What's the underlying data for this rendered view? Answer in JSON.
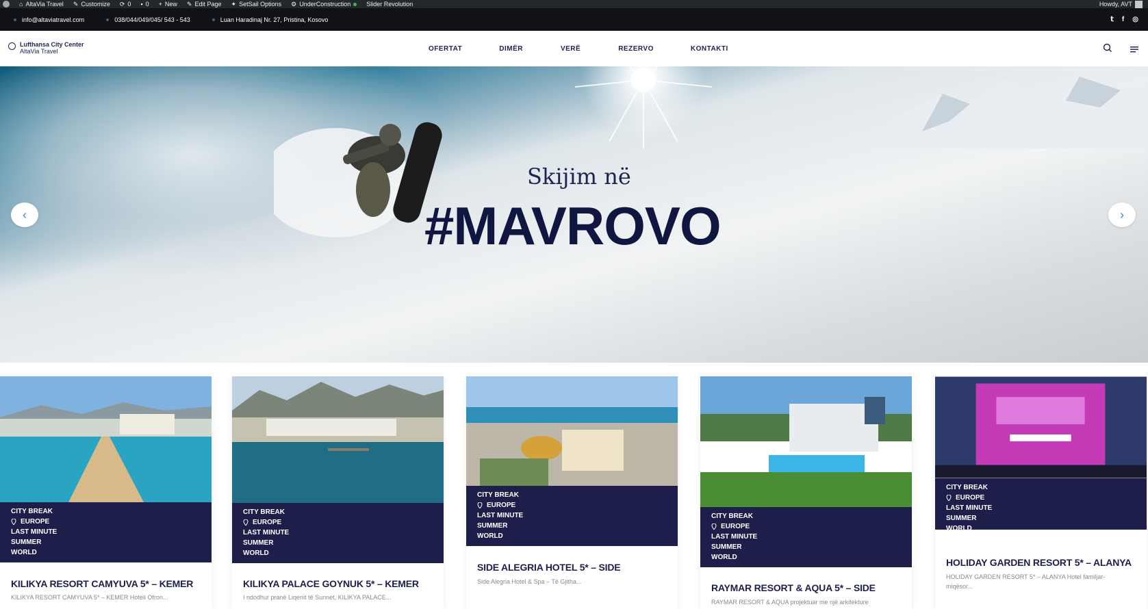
{
  "adminbar": {
    "site": "AltaVia Travel",
    "customize": "Customize",
    "updates_count": "0",
    "comments_count": "0",
    "new": "New",
    "edit_page": "Edit Page",
    "setsail": "SetSail Options",
    "underconstruction": "UnderConstruction",
    "slider": "Slider Revolution",
    "howdy": "Howdy, AVT"
  },
  "topbar": {
    "email": "info@altaviatravel.com",
    "phones": "038/044/049/045/ 543 - 543",
    "address": "Luan Haradinaj Nr. 27, Pristina, Kosovo",
    "social": [
      "twitter-icon",
      "facebook-icon",
      "instagram-icon"
    ],
    "social_glyphs": [
      "𝕥",
      "f",
      "◎"
    ]
  },
  "header": {
    "logo_line1": "Lufthansa City Center",
    "logo_line2": "AltaVia Travel",
    "nav": [
      "OFERTAT",
      "DIMËR",
      "VERË",
      "REZERVO",
      "KONTAKTI"
    ]
  },
  "hero": {
    "subtitle": "Skijim në",
    "title": "#MAVROVO",
    "prev_glyph": "‹",
    "next_glyph": "›"
  },
  "cards": [
    {
      "tags": [
        "CITY BREAK",
        "EUROPE",
        "LAST MINUTE",
        "SUMMER",
        "WORLD"
      ],
      "title": "KILIKYA RESORT CAMYUVA 5* – KEMER",
      "desc": "KILIKYA RESORT CAMYUVA 5* – KEMER Hoteli Ofron..."
    },
    {
      "tags": [
        "CITY BREAK",
        "EUROPE",
        "LAST MINUTE",
        "SUMMER",
        "WORLD"
      ],
      "title": "KILIKYA PALACE GOYNUK 5* – KEMER",
      "desc": "I ndodhur pranë Liqenit të Sunnet, KILIKYA PALACE..."
    },
    {
      "tags": [
        "CITY BREAK",
        "EUROPE",
        "LAST MINUTE",
        "SUMMER",
        "WORLD"
      ],
      "title": "SIDE ALEGRIA HOTEL 5* – SIDE",
      "desc": "Side Alegria Hotel & Spa – Të Gjitha..."
    },
    {
      "tags": [
        "CITY BREAK",
        "EUROPE",
        "LAST MINUTE",
        "SUMMER",
        "WORLD"
      ],
      "title": "RAYMAR RESORT & AQUA 5* – SIDE",
      "desc": "RAYMAR RESORT & AQUA projektuar me një arkitekture"
    },
    {
      "tags": [
        "CITY BREAK",
        "EUROPE",
        "LAST MINUTE",
        "SUMMER",
        "WORLD"
      ],
      "title": "HOLIDAY GARDEN RESORT 5* – ALANYA",
      "desc": "HOLIDAY GARDEN RESORT 5* – ALANYA Hotel familjar-miqësor..."
    }
  ],
  "colors": {
    "brand_navy": "#1e1e4b",
    "accent_blue": "#2f8fd3",
    "adminbar_bg": "#23282d",
    "topbar_bg": "#101218"
  }
}
